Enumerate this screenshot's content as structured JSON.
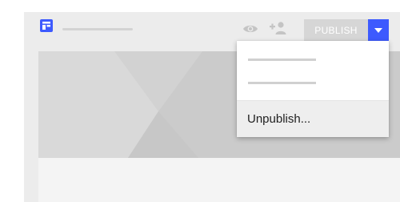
{
  "toolbar": {
    "publish_label": "PUBLISH",
    "icons": {
      "app": "dashboard-icon",
      "preview": "eye-icon",
      "share": "add-person-icon",
      "dropdown": "caret-down-icon"
    }
  },
  "menu": {
    "unpublish_label": "Unpublish..."
  },
  "colors": {
    "accent": "#3d5afe",
    "publish_disabled": "#d6d6d6",
    "canvas": "#ececec",
    "banner": "#d9d9d9"
  }
}
